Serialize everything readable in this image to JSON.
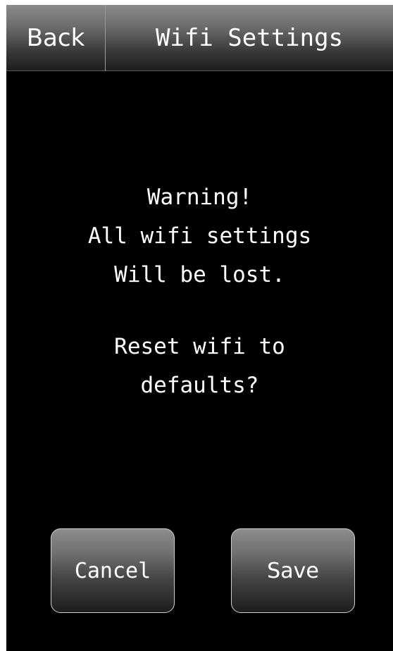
{
  "header": {
    "back_label": "Back",
    "title": "Wifi Settings"
  },
  "message": {
    "line1": "Warning!",
    "line2": "All wifi settings",
    "line3": "Will be lost.",
    "line4": "Reset wifi to",
    "line5": "defaults?"
  },
  "buttons": {
    "cancel_label": "Cancel",
    "save_label": "Save"
  },
  "colors": {
    "background": "#000000",
    "text": "#ffffff",
    "header_gradient_top": "#8a8a8a",
    "header_gradient_bottom": "#1e1e1e",
    "button_border": "#d0d0d0"
  }
}
